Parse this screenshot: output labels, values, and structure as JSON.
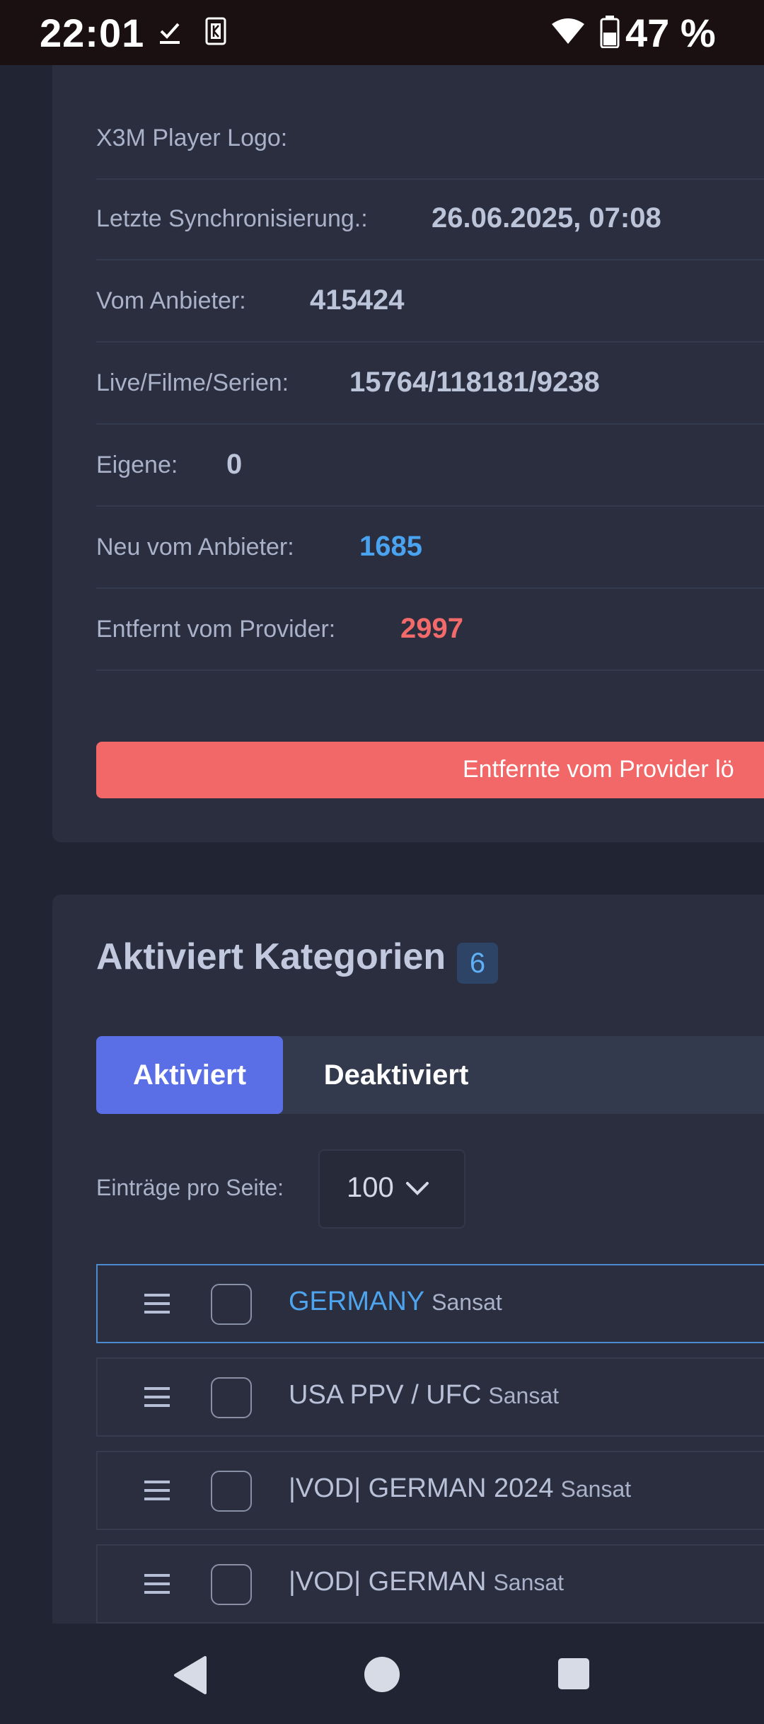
{
  "status_bar": {
    "time": "22:01",
    "battery_percent": "47 %",
    "icons": [
      "download-done-icon",
      "k-icon",
      "wifi-icon",
      "battery-icon"
    ]
  },
  "info": {
    "rows": [
      {
        "label": "X3M Player Logo:",
        "value": ""
      },
      {
        "label": "Letzte Synchronisierung.:",
        "value": "26.06.2025, 07:08"
      },
      {
        "label": "Vom Anbieter:",
        "value": "415424"
      },
      {
        "label": "Live/Filme/Serien:",
        "value": "15764/118181/9238"
      },
      {
        "label": "Eigene:",
        "value": "0"
      },
      {
        "label": "Neu vom Anbieter:",
        "value": "1685"
      },
      {
        "label": "Entfernt vom Provider:",
        "value": "2997"
      }
    ],
    "delete_button_label": "Entfernte vom Provider lö"
  },
  "categories": {
    "title": "Aktiviert Kategorien",
    "count": "6",
    "tabs": [
      {
        "label": "Aktiviert",
        "active": true
      },
      {
        "label": "Deaktiviert",
        "active": false
      }
    ],
    "entries_label": "Einträge pro Seite:",
    "entries_value": "100",
    "items": [
      {
        "name": "GERMANY",
        "sub": "Sansat"
      },
      {
        "name": "USA PPV / UFC",
        "sub": "Sansat"
      },
      {
        "name": "|VOD| GERMAN 2024",
        "sub": "Sansat"
      },
      {
        "name": "|VOD| GERMAN",
        "sub": "Sansat"
      }
    ]
  },
  "colors": {
    "background": "#212533",
    "card": "#2a2e3f",
    "accent_blue": "#5a6ee6",
    "value_blue": "#4aa3f0",
    "value_red": "#f26a6a",
    "danger_button": "#f26868"
  }
}
